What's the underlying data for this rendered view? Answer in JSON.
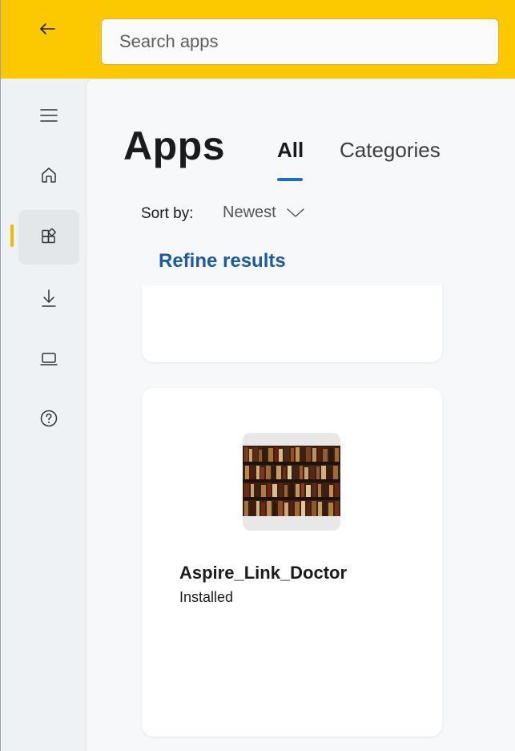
{
  "topbar": {
    "back_icon": "arrow-left-icon",
    "search_placeholder": "Search apps",
    "accent_color": "#fcc900"
  },
  "rail": {
    "items": [
      {
        "id": "menu",
        "icon": "hamburger-menu-icon"
      },
      {
        "id": "home",
        "icon": "home-icon"
      },
      {
        "id": "apps",
        "icon": "apps-grid-icon",
        "active": true
      },
      {
        "id": "downloads",
        "icon": "download-icon"
      },
      {
        "id": "devices",
        "icon": "laptop-icon"
      },
      {
        "id": "help",
        "icon": "help-icon"
      }
    ],
    "indicator_color": "#f2b900"
  },
  "main": {
    "title": "Apps",
    "tabs": [
      {
        "label": "All",
        "selected": true
      },
      {
        "label": "Categories",
        "selected": false
      }
    ],
    "sort": {
      "label": "Sort by:",
      "value": "Newest"
    },
    "refine_label": "Refine results",
    "link_color": "#1a5aa8"
  },
  "cards": [
    {
      "name": "Aspire_Link_Doctor",
      "status": "Installed",
      "thumbnail": "bookshelf-image"
    }
  ]
}
